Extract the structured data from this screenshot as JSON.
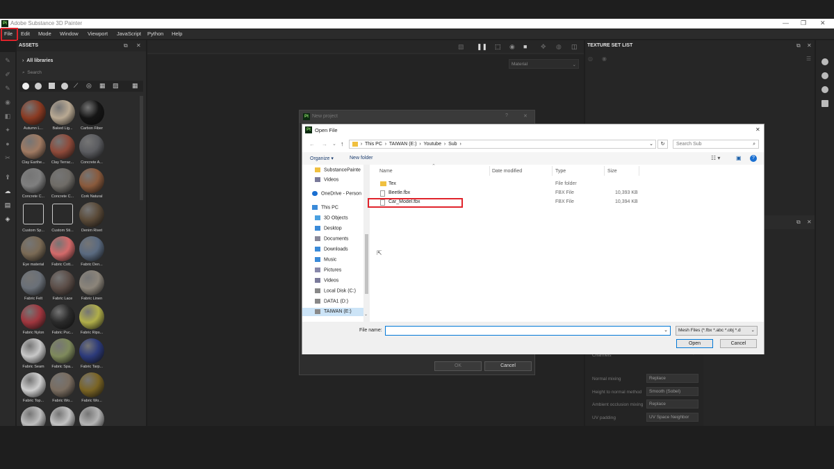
{
  "window": {
    "title": "Adobe Substance 3D Painter",
    "logo": "Pt"
  },
  "menu": [
    "File",
    "Edit",
    "Mode",
    "Window",
    "Viewport",
    "JavaScript",
    "Python",
    "Help"
  ],
  "assets": {
    "title": "ASSETS",
    "library": "All libraries",
    "search_placeholder": "Search",
    "items": [
      {
        "label": "Autumn L...",
        "color": "#8a3a22"
      },
      {
        "label": "Baked Lig...",
        "color": "#b9a993"
      },
      {
        "label": "Carbon Fiber",
        "color": "#151515"
      },
      {
        "label": "Clay Earthe...",
        "color": "#a07a62"
      },
      {
        "label": "Clay Terrac...",
        "color": "#8f4a3a"
      },
      {
        "label": "Concrete A...",
        "color": "#5b5c60"
      },
      {
        "label": "Concrete C...",
        "color": "#7f7f7f"
      },
      {
        "label": "Concrete C...",
        "color": "#6f6c67"
      },
      {
        "label": "Cork Natural",
        "color": "#8a5a3c"
      },
      {
        "label": "Custom Sp...",
        "color": "#2e2e2e"
      },
      {
        "label": "Custom Sti...",
        "color": "#2e2e2e"
      },
      {
        "label": "Denim Rivet",
        "color": "#5a4a38"
      },
      {
        "label": "Eye material",
        "color": "#7a6a55"
      },
      {
        "label": "Fabric Cott...",
        "color": "#d46a6a"
      },
      {
        "label": "Fabric Den...",
        "color": "#5a6a80"
      },
      {
        "label": "Fabric Felt",
        "color": "#6a7078"
      },
      {
        "label": "Fabric Lace",
        "color": "#5b4d47"
      },
      {
        "label": "Fabric Linen",
        "color": "#8c857a"
      },
      {
        "label": "Fabric Nylon",
        "color": "#a0363e"
      },
      {
        "label": "Fabric Puc...",
        "color": "#2a2a2a"
      },
      {
        "label": "Fabric Rips...",
        "color": "#b0ae4a"
      },
      {
        "label": "Fabric Seam",
        "color": "#c8c8c8"
      },
      {
        "label": "Fabric Spa...",
        "color": "#7f8a5c"
      },
      {
        "label": "Fabric Tarp...",
        "color": "#2c3a7a"
      },
      {
        "label": "Fabric Top...",
        "color": "#cfcfcf"
      },
      {
        "label": "Fabric Wo...",
        "color": "#7a6d60"
      },
      {
        "label": "Fabric Wo...",
        "color": "#7a6424"
      },
      {
        "label": "",
        "color": "#bdbdbd"
      },
      {
        "label": "",
        "color": "#c2c2c2"
      },
      {
        "label": "",
        "color": "#b4b4b4"
      }
    ]
  },
  "viewport": {
    "material_select": "Material"
  },
  "texture_set": {
    "title": "TEXTURE SET LIST"
  },
  "settings": {
    "channels_label": "Channels",
    "rows": [
      {
        "label": "Normal mixing",
        "value": "Replace"
      },
      {
        "label": "Height to normal method",
        "value": "Smooth (Sobel)"
      },
      {
        "label": "Ambient occlusion mixing",
        "value": "Replace"
      },
      {
        "label": "UV padding",
        "value": "UV Space Neighbor"
      }
    ]
  },
  "new_project": {
    "title": "New project",
    "help": "?",
    "ok": "OK",
    "cancel": "Cancel"
  },
  "open_file": {
    "title": "Open File",
    "path": [
      "This PC",
      "TAIWAN (E:)",
      "Youtube",
      "Sub"
    ],
    "search_placeholder": "Search Sub",
    "organize": "Organize",
    "new_folder": "New folder",
    "tree": [
      {
        "label": "SubstancePainte",
        "icon": "folder-icon"
      },
      {
        "label": "Videos",
        "icon": "video-folder-icon"
      },
      {
        "label": "OneDrive - Person",
        "icon": "cloud-icon"
      },
      {
        "label": "This PC",
        "icon": "computer-icon"
      },
      {
        "label": "3D Objects",
        "icon": "cube-folder-icon"
      },
      {
        "label": "Desktop",
        "icon": "desktop-icon"
      },
      {
        "label": "Documents",
        "icon": "document-folder-icon"
      },
      {
        "label": "Downloads",
        "icon": "download-folder-icon"
      },
      {
        "label": "Music",
        "icon": "music-icon"
      },
      {
        "label": "Pictures",
        "icon": "picture-folder-icon"
      },
      {
        "label": "Videos",
        "icon": "video-folder-icon"
      },
      {
        "label": "Local Disk (C:)",
        "icon": "drive-icon"
      },
      {
        "label": "DATA1 (D:)",
        "icon": "drive-icon"
      },
      {
        "label": "TAIWAN (E:)",
        "icon": "drive-icon"
      }
    ],
    "columns": [
      "Name",
      "Date modified",
      "Type",
      "Size"
    ],
    "files": [
      {
        "name": "Tex",
        "type": "File folder",
        "size": "",
        "icon": "folder-icon"
      },
      {
        "name": "Beetle.fbx",
        "type": "FBX File",
        "size": "10,393 KB",
        "icon": "file-icon"
      },
      {
        "name": "Car_Model.fbx",
        "type": "FBX File",
        "size": "10,394 KB",
        "icon": "file-icon"
      }
    ],
    "file_name_label": "File name:",
    "file_name_value": "",
    "filter": "Mesh Files (*.fbx *.abc *.obj *.d",
    "open": "Open",
    "cancel": "Cancel"
  },
  "colors": {
    "highlight": "#e0232b",
    "accent": "#0078d7"
  }
}
